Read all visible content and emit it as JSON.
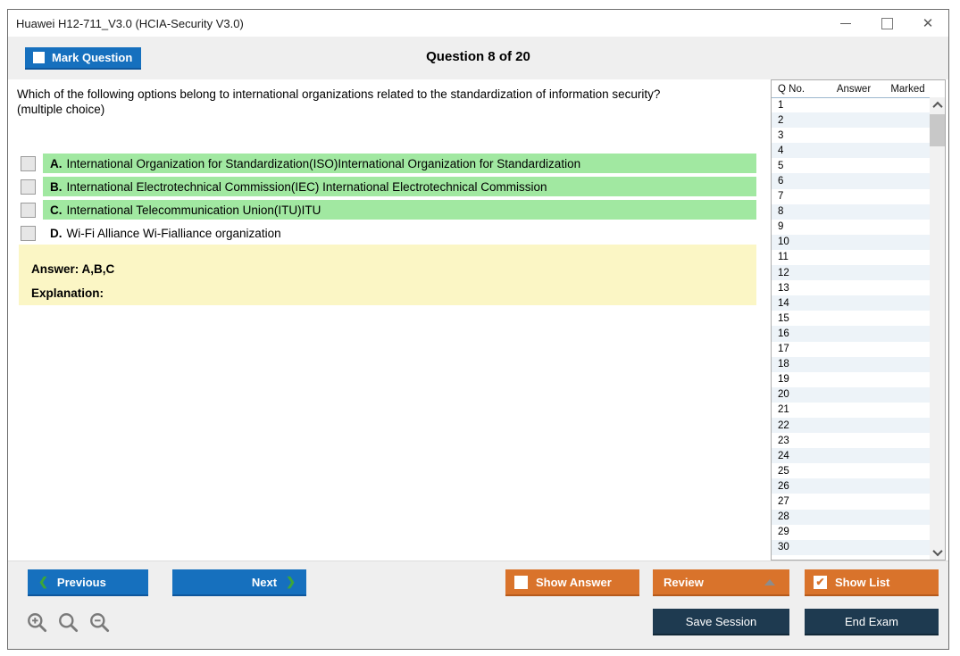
{
  "window": {
    "title": "Huawei H12-711_V3.0 (HCIA-Security V3.0)"
  },
  "header": {
    "mark_question": "Mark Question",
    "counter": "Question 8 of 20"
  },
  "question": {
    "text": "Which of the following options belong to international organizations related to the standardization of information security?\n(multiple choice)",
    "options": [
      {
        "letter": "A.",
        "text": "International Organization for Standardization(ISO)International Organization for Standardization",
        "highlighted": true
      },
      {
        "letter": "B.",
        "text": "International Electrotechnical Commission(IEC) International Electrotechnical Commission",
        "highlighted": true
      },
      {
        "letter": "C.",
        "text": "International Telecommunication Union(ITU)ITU",
        "highlighted": true
      },
      {
        "letter": "D.",
        "text": "Wi-Fi Alliance Wi-Fialliance organization",
        "highlighted": false
      }
    ]
  },
  "answer_panel": {
    "answer": "Answer: A,B,C",
    "explanation": "Explanation:"
  },
  "question_list": {
    "headers": [
      "Q No.",
      "Answer",
      "Marked"
    ],
    "rows": [
      {
        "q": "1",
        "answer": "",
        "marked": ""
      },
      {
        "q": "2",
        "answer": "",
        "marked": ""
      },
      {
        "q": "3",
        "answer": "",
        "marked": ""
      },
      {
        "q": "4",
        "answer": "",
        "marked": ""
      },
      {
        "q": "5",
        "answer": "",
        "marked": ""
      },
      {
        "q": "6",
        "answer": "",
        "marked": ""
      },
      {
        "q": "7",
        "answer": "",
        "marked": ""
      },
      {
        "q": "8",
        "answer": "",
        "marked": ""
      },
      {
        "q": "9",
        "answer": "",
        "marked": ""
      },
      {
        "q": "10",
        "answer": "",
        "marked": ""
      },
      {
        "q": "11",
        "answer": "",
        "marked": ""
      },
      {
        "q": "12",
        "answer": "",
        "marked": ""
      },
      {
        "q": "13",
        "answer": "",
        "marked": ""
      },
      {
        "q": "14",
        "answer": "",
        "marked": ""
      },
      {
        "q": "15",
        "answer": "",
        "marked": ""
      },
      {
        "q": "16",
        "answer": "",
        "marked": ""
      },
      {
        "q": "17",
        "answer": "",
        "marked": ""
      },
      {
        "q": "18",
        "answer": "",
        "marked": ""
      },
      {
        "q": "19",
        "answer": "",
        "marked": ""
      },
      {
        "q": "20",
        "answer": "",
        "marked": ""
      },
      {
        "q": "21",
        "answer": "",
        "marked": ""
      },
      {
        "q": "22",
        "answer": "",
        "marked": ""
      },
      {
        "q": "23",
        "answer": "",
        "marked": ""
      },
      {
        "q": "24",
        "answer": "",
        "marked": ""
      },
      {
        "q": "25",
        "answer": "",
        "marked": ""
      },
      {
        "q": "26",
        "answer": "",
        "marked": ""
      },
      {
        "q": "27",
        "answer": "",
        "marked": ""
      },
      {
        "q": "28",
        "answer": "",
        "marked": ""
      },
      {
        "q": "29",
        "answer": "",
        "marked": ""
      },
      {
        "q": "30",
        "answer": "",
        "marked": ""
      }
    ]
  },
  "footer": {
    "previous": "Previous",
    "next": "Next",
    "show_answer": "Show Answer",
    "review": "Review",
    "show_list": "Show List",
    "save_session": "Save Session",
    "end_exam": "End Exam",
    "prev_chevron": "❮",
    "next_chevron": "❯",
    "show_list_check": "✔"
  },
  "titlebar_icons": {
    "close": "✕"
  },
  "colors": {
    "accent_blue": "#1670BE",
    "accent_orange": "#D9732B",
    "navy": "#1E3A50",
    "highlight_green": "#A1E8A1",
    "answer_yellow": "#FBF6C5",
    "chevron_green": "#3DA639",
    "alt_row_blue": "#EDF3F8"
  }
}
